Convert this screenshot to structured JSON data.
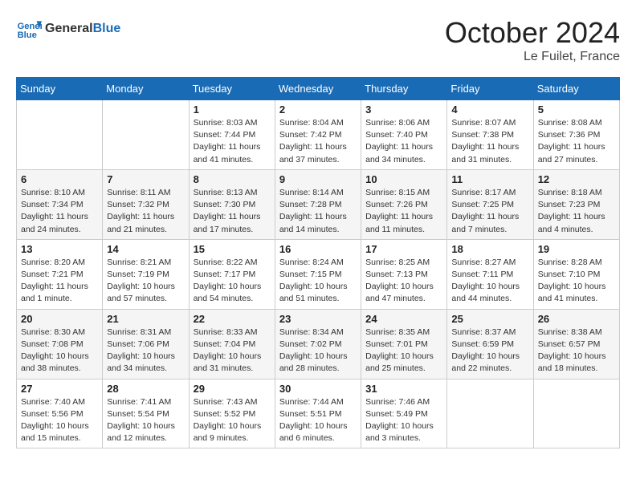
{
  "header": {
    "logo_line1": "General",
    "logo_line2": "Blue",
    "month": "October 2024",
    "location": "Le Fuilet, France"
  },
  "days_of_week": [
    "Sunday",
    "Monday",
    "Tuesday",
    "Wednesday",
    "Thursday",
    "Friday",
    "Saturday"
  ],
  "weeks": [
    [
      {
        "day": "",
        "info": ""
      },
      {
        "day": "",
        "info": ""
      },
      {
        "day": "1",
        "info": "Sunrise: 8:03 AM\nSunset: 7:44 PM\nDaylight: 11 hours and 41 minutes."
      },
      {
        "day": "2",
        "info": "Sunrise: 8:04 AM\nSunset: 7:42 PM\nDaylight: 11 hours and 37 minutes."
      },
      {
        "day": "3",
        "info": "Sunrise: 8:06 AM\nSunset: 7:40 PM\nDaylight: 11 hours and 34 minutes."
      },
      {
        "day": "4",
        "info": "Sunrise: 8:07 AM\nSunset: 7:38 PM\nDaylight: 11 hours and 31 minutes."
      },
      {
        "day": "5",
        "info": "Sunrise: 8:08 AM\nSunset: 7:36 PM\nDaylight: 11 hours and 27 minutes."
      }
    ],
    [
      {
        "day": "6",
        "info": "Sunrise: 8:10 AM\nSunset: 7:34 PM\nDaylight: 11 hours and 24 minutes."
      },
      {
        "day": "7",
        "info": "Sunrise: 8:11 AM\nSunset: 7:32 PM\nDaylight: 11 hours and 21 minutes."
      },
      {
        "day": "8",
        "info": "Sunrise: 8:13 AM\nSunset: 7:30 PM\nDaylight: 11 hours and 17 minutes."
      },
      {
        "day": "9",
        "info": "Sunrise: 8:14 AM\nSunset: 7:28 PM\nDaylight: 11 hours and 14 minutes."
      },
      {
        "day": "10",
        "info": "Sunrise: 8:15 AM\nSunset: 7:26 PM\nDaylight: 11 hours and 11 minutes."
      },
      {
        "day": "11",
        "info": "Sunrise: 8:17 AM\nSunset: 7:25 PM\nDaylight: 11 hours and 7 minutes."
      },
      {
        "day": "12",
        "info": "Sunrise: 8:18 AM\nSunset: 7:23 PM\nDaylight: 11 hours and 4 minutes."
      }
    ],
    [
      {
        "day": "13",
        "info": "Sunrise: 8:20 AM\nSunset: 7:21 PM\nDaylight: 11 hours and 1 minute."
      },
      {
        "day": "14",
        "info": "Sunrise: 8:21 AM\nSunset: 7:19 PM\nDaylight: 10 hours and 57 minutes."
      },
      {
        "day": "15",
        "info": "Sunrise: 8:22 AM\nSunset: 7:17 PM\nDaylight: 10 hours and 54 minutes."
      },
      {
        "day": "16",
        "info": "Sunrise: 8:24 AM\nSunset: 7:15 PM\nDaylight: 10 hours and 51 minutes."
      },
      {
        "day": "17",
        "info": "Sunrise: 8:25 AM\nSunset: 7:13 PM\nDaylight: 10 hours and 47 minutes."
      },
      {
        "day": "18",
        "info": "Sunrise: 8:27 AM\nSunset: 7:11 PM\nDaylight: 10 hours and 44 minutes."
      },
      {
        "day": "19",
        "info": "Sunrise: 8:28 AM\nSunset: 7:10 PM\nDaylight: 10 hours and 41 minutes."
      }
    ],
    [
      {
        "day": "20",
        "info": "Sunrise: 8:30 AM\nSunset: 7:08 PM\nDaylight: 10 hours and 38 minutes."
      },
      {
        "day": "21",
        "info": "Sunrise: 8:31 AM\nSunset: 7:06 PM\nDaylight: 10 hours and 34 minutes."
      },
      {
        "day": "22",
        "info": "Sunrise: 8:33 AM\nSunset: 7:04 PM\nDaylight: 10 hours and 31 minutes."
      },
      {
        "day": "23",
        "info": "Sunrise: 8:34 AM\nSunset: 7:02 PM\nDaylight: 10 hours and 28 minutes."
      },
      {
        "day": "24",
        "info": "Sunrise: 8:35 AM\nSunset: 7:01 PM\nDaylight: 10 hours and 25 minutes."
      },
      {
        "day": "25",
        "info": "Sunrise: 8:37 AM\nSunset: 6:59 PM\nDaylight: 10 hours and 22 minutes."
      },
      {
        "day": "26",
        "info": "Sunrise: 8:38 AM\nSunset: 6:57 PM\nDaylight: 10 hours and 18 minutes."
      }
    ],
    [
      {
        "day": "27",
        "info": "Sunrise: 7:40 AM\nSunset: 5:56 PM\nDaylight: 10 hours and 15 minutes."
      },
      {
        "day": "28",
        "info": "Sunrise: 7:41 AM\nSunset: 5:54 PM\nDaylight: 10 hours and 12 minutes."
      },
      {
        "day": "29",
        "info": "Sunrise: 7:43 AM\nSunset: 5:52 PM\nDaylight: 10 hours and 9 minutes."
      },
      {
        "day": "30",
        "info": "Sunrise: 7:44 AM\nSunset: 5:51 PM\nDaylight: 10 hours and 6 minutes."
      },
      {
        "day": "31",
        "info": "Sunrise: 7:46 AM\nSunset: 5:49 PM\nDaylight: 10 hours and 3 minutes."
      },
      {
        "day": "",
        "info": ""
      },
      {
        "day": "",
        "info": ""
      }
    ]
  ]
}
